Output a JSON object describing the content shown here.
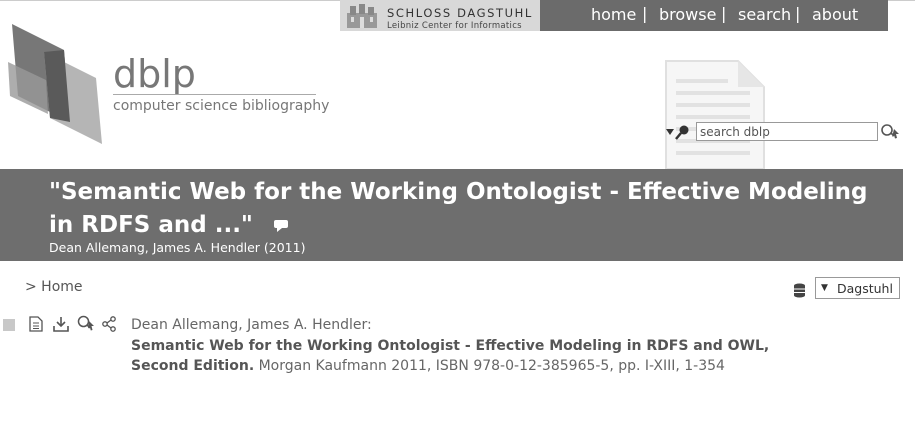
{
  "header": {
    "dagstuhl": {
      "name": "SCHLOSS DAGSTUHL",
      "subtitle": "Leibniz Center for Informatics"
    },
    "nav": [
      {
        "label": "home"
      },
      {
        "label": "browse"
      },
      {
        "label": "search"
      },
      {
        "label": "about"
      }
    ],
    "separator": "|"
  },
  "logo": {
    "name": "dblp",
    "tagline": "computer science bibliography"
  },
  "search": {
    "placeholder": "search dblp",
    "icons": [
      "search-options-icon",
      "search-help-icon"
    ]
  },
  "page": {
    "title": "\"Semantic Web for the Working Ontologist - Effective Modeling in RDFS and ...\"",
    "subtitle": "Dean Allemang, James A. Hendler (2011)"
  },
  "breadcrumb": "> Home",
  "mirror": {
    "selected": "Dagstuhl"
  },
  "entry": {
    "authors": "Dean Allemang, James A. Hendler:",
    "title": "Semantic Web for the Working Ontologist - Effective Modeling in RDFS and OWL, Second Edition.",
    "details": " Morgan Kaufmann 2011, ISBN 978-0-12-385965-5, pp. I-XIII, 1-354",
    "icons": [
      "electronic-edition-icon",
      "export-icon",
      "search-icon",
      "share-icon"
    ]
  },
  "colors": {
    "nav_bg": "#6b6b6b",
    "banner_bg": "#6e6e6e",
    "dagstuhl_bg": "#d8d8d8"
  }
}
